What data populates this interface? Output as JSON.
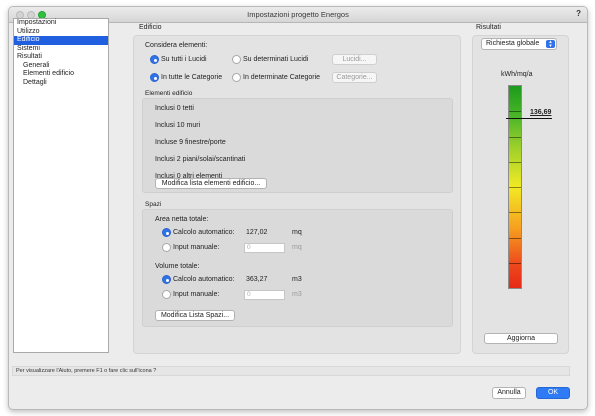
{
  "window": {
    "title": "Impostazioni progetto Energos",
    "help_label": "?"
  },
  "sidebar": {
    "items": [
      {
        "label": "Impostazioni"
      },
      {
        "label": "Utilizzo"
      },
      {
        "label": "Edificio",
        "selected": true
      },
      {
        "label": "Sistemi"
      },
      {
        "label": "Risultati"
      },
      {
        "label": "Generali",
        "sub": true
      },
      {
        "label": "Elementi edificio",
        "sub": true
      },
      {
        "label": "Dettagli",
        "sub": true
      }
    ]
  },
  "edificio": {
    "section_title": "Edificio",
    "considera_label": "Considera elementi:",
    "radio_tutti_lucidi": "Su tutti i Lucidi",
    "radio_determinati_lucidi": "Su determinati Lucidi",
    "lucidi_button": "Lucidi...",
    "radio_tutte_categorie": "In tutte le Categorie",
    "radio_determinate_categorie": "In determinate Categorie",
    "categorie_button": "Categorie...",
    "elementi_title": "Elementi edificio",
    "elementi": [
      "Inclusi 0 tetti",
      "Inclusi 10 muri",
      "Incluse 9 finestre/porte",
      "Inclusi 2 piani/solai/scantinati",
      "Inclusi 0 altri elementi"
    ],
    "modifica_elementi_button": "Modifica lista elementi edificio..."
  },
  "spazi": {
    "section_title": "Spazi",
    "area_label": "Area netta totale:",
    "area_auto_label": "Calcolo automatico:",
    "area_auto_value": "127,02",
    "area_unit": "mq",
    "area_manual_label": "Input manuale:",
    "area_manual_placeholder": "0",
    "area_manual_unit": "mq",
    "volume_label": "Volume totale:",
    "volume_auto_label": "Calcolo automatico:",
    "volume_auto_value": "363,27",
    "volume_unit": "m3",
    "volume_manual_label": "Input manuale:",
    "volume_manual_placeholder": "0",
    "volume_manual_unit": "m3",
    "modifica_spazi_button": "Modifica Lista Spazi..."
  },
  "risultati": {
    "section_title": "Risultati",
    "dropdown_value": "Richiesta globale",
    "unit_label": "kWh/mq/a",
    "value_label": "136,69",
    "marker_fraction": 0.16,
    "aggiorna_button": "Aggiorna"
  },
  "status": {
    "text": "Per visualizzare l'Aiuto, premere F1 o fare clic sull'icona ?"
  },
  "footer": {
    "cancel_button": "Annulla",
    "ok_button": "OK"
  },
  "colors": {
    "selection": "#1f5fe0",
    "primary_button": "#2f7bf5"
  }
}
